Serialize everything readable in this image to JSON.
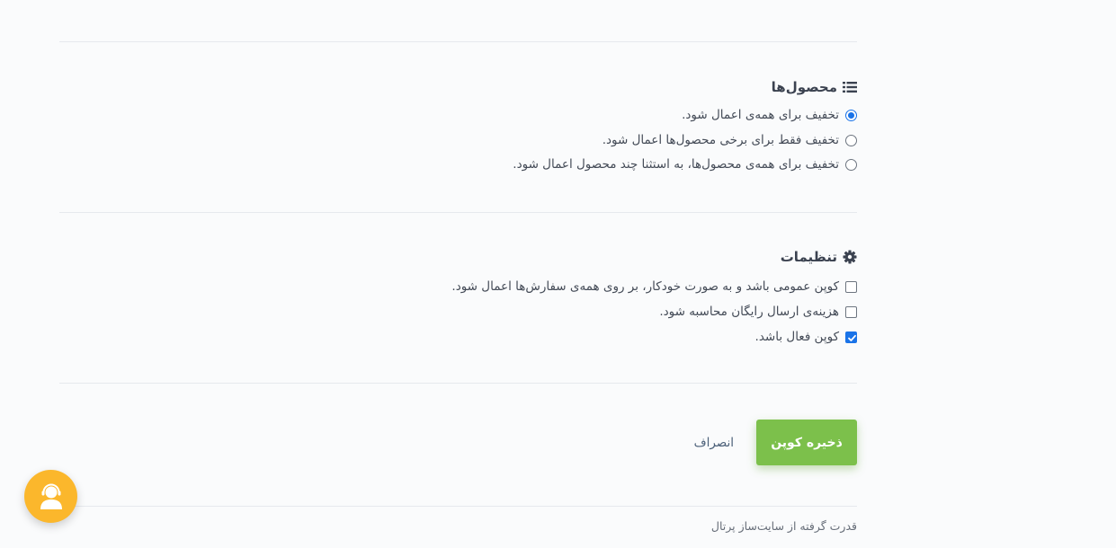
{
  "products": {
    "title": "محصول‌ها",
    "title_icon": "list-icon",
    "options": [
      {
        "label": "تخفیف برای همه‌ی اعمال شود.",
        "selected": true
      },
      {
        "label": "تخفیف فقط برای برخی محصول‌ها اعمال شود.",
        "selected": false
      },
      {
        "label": "تخفیف برای همه‌ی محصول‌ها، به استثنا چند محصول اعمال شود.",
        "selected": false
      }
    ]
  },
  "settings": {
    "title": "تنظیمات",
    "title_icon": "gear-icon",
    "options": [
      {
        "label": "کوپن عمومی باشد و به صورت خودکار، بر روی همه‌ی سفارش‌ها اعمال شود.",
        "checked": false
      },
      {
        "label": "هزینه‌ی ارسال رایگان محاسبه شود.",
        "checked": false
      },
      {
        "label": "کوپن فعال باشد.",
        "checked": true
      }
    ]
  },
  "actions": {
    "save_label": "ذخیره کوپن",
    "cancel_label": "انصراف"
  },
  "footer": {
    "powered_by": "قدرت گرفته از سایت‌ساز پرتال"
  },
  "support": {
    "icon": "user-support-icon"
  },
  "colors": {
    "accent": "#1a73e8",
    "save_button": "#7cc04b",
    "support_button": "#fbb72c"
  }
}
